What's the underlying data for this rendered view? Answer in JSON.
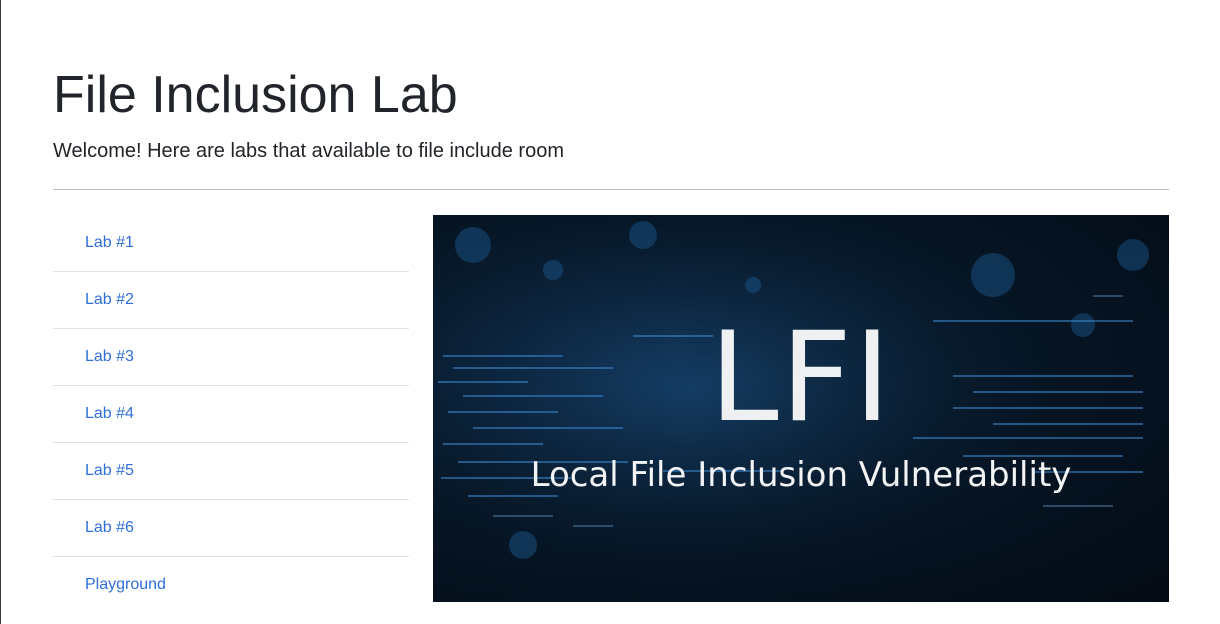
{
  "page": {
    "title": "File Inclusion Lab",
    "lead": "Welcome! Here are labs that available to file include room"
  },
  "labs": [
    {
      "label": "Lab #1"
    },
    {
      "label": "Lab #2"
    },
    {
      "label": "Lab #3"
    },
    {
      "label": "Lab #4"
    },
    {
      "label": "Lab #5"
    },
    {
      "label": "Lab #6"
    },
    {
      "label": "Playground"
    }
  ],
  "banner": {
    "big_text": "LFI",
    "subtitle": "Local File Inclusion Vulnerability"
  },
  "colors": {
    "link": "#2f6fd9",
    "text": "#212529",
    "banner_bg": "#071727"
  }
}
